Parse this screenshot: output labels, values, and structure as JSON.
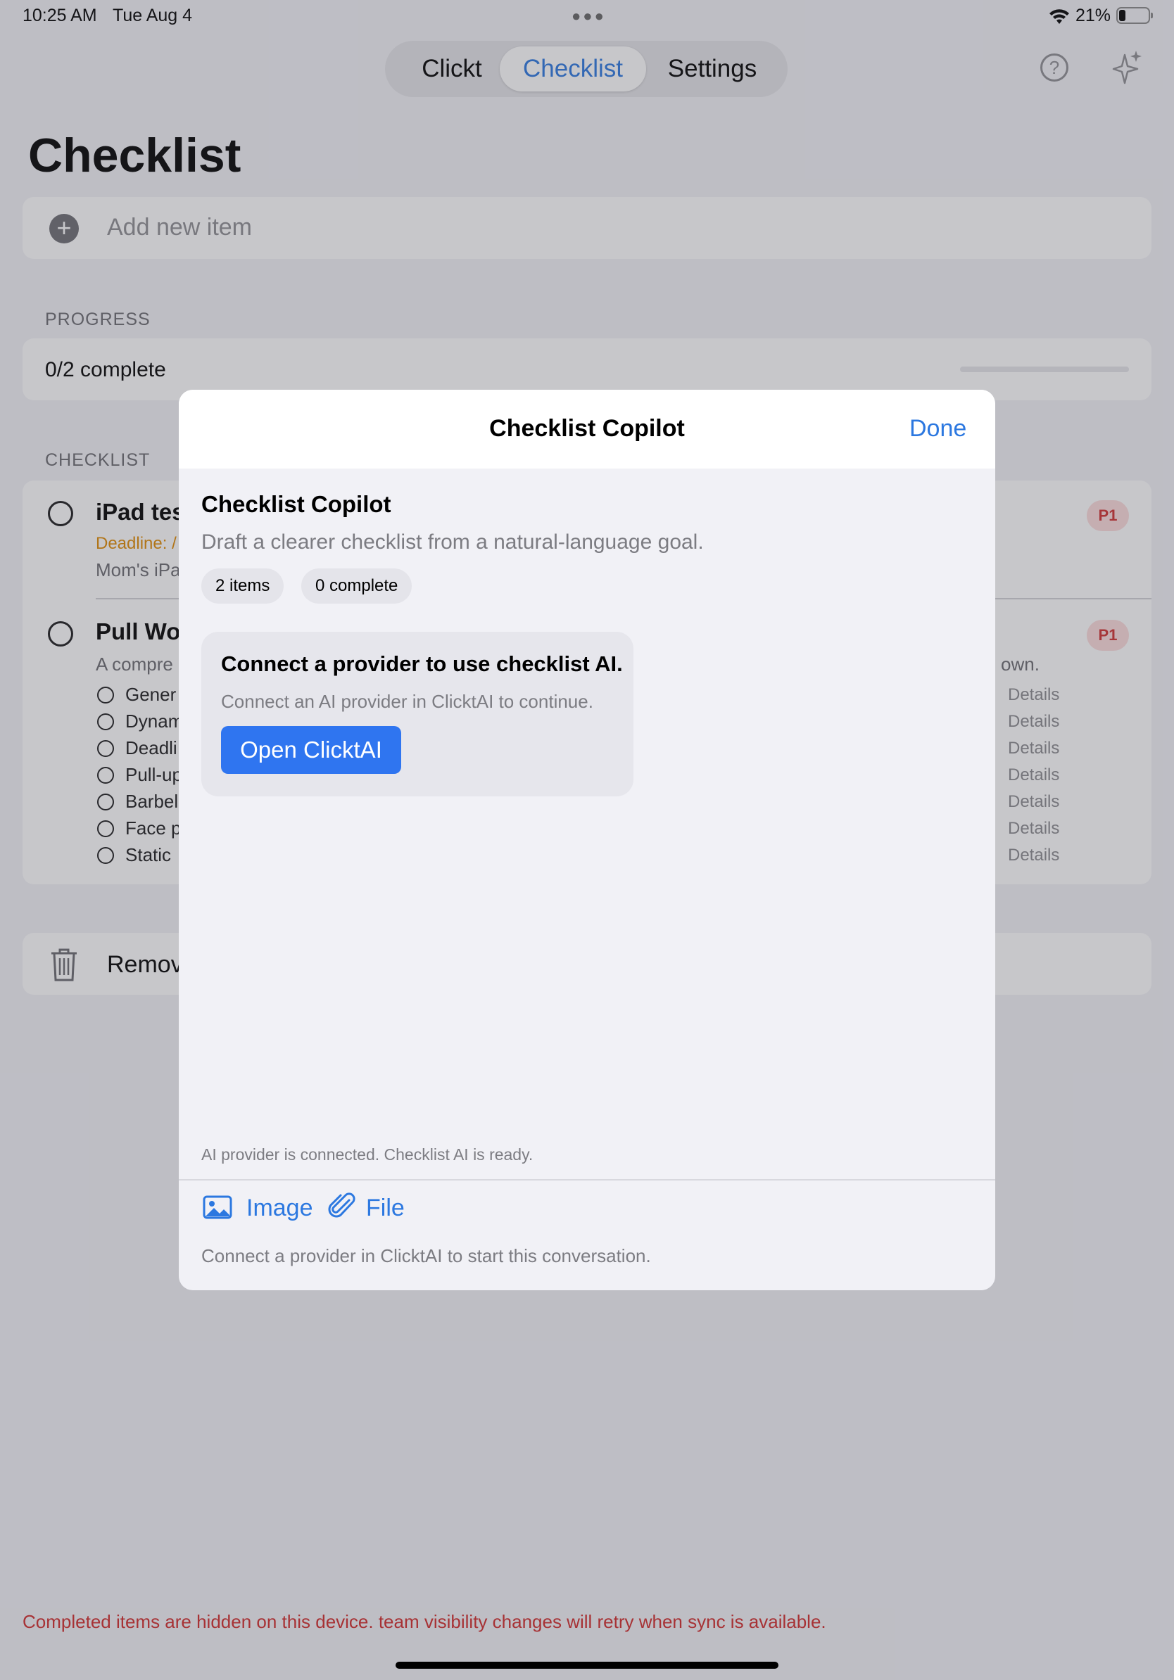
{
  "status_bar": {
    "time": "10:25 AM",
    "date": "Tue Aug 4",
    "battery": "21%"
  },
  "nav": {
    "tabs": [
      "Clickt",
      "Checklist",
      "Settings"
    ],
    "selected": "Checklist"
  },
  "page": {
    "title": "Checklist",
    "add_placeholder": "Add new item"
  },
  "progress": {
    "header": "PROGRESS",
    "text": "0/2 complete",
    "fraction": 0
  },
  "checklist": {
    "header": "CHECKLIST",
    "items": [
      {
        "title": "iPad tes",
        "deadline": "Deadline: /",
        "note": "Mom's iPa",
        "priority": "P1"
      },
      {
        "title": "Pull Wo",
        "description": "A compre",
        "description_end": "own.",
        "priority": "P1",
        "subitems": [
          {
            "label": "Gener",
            "action": "Details"
          },
          {
            "label": "Dynam",
            "action": "Details"
          },
          {
            "label": "Deadli",
            "action": "Details"
          },
          {
            "label": "Pull-up",
            "action": "Details"
          },
          {
            "label": "Barbel",
            "action": "Details"
          },
          {
            "label": "Face p",
            "action": "Details"
          },
          {
            "label": "Static",
            "action": "Details"
          }
        ]
      }
    ]
  },
  "remove": {
    "label": "Remov"
  },
  "footer": {
    "warning": "Completed items are hidden on this device. team visibility changes will retry when sync is available."
  },
  "sheet": {
    "title": "Checklist Copilot",
    "done": "Done",
    "heading": "Checklist Copilot",
    "subtitle": "Draft a clearer checklist from a natural-language goal.",
    "chips": [
      "2 items",
      "0 complete"
    ],
    "card": {
      "title": "Connect a provider to use checklist AI.",
      "body": "Connect an AI provider in ClicktAI to continue.",
      "button": "Open ClicktAI"
    },
    "status": "AI provider is connected. Checklist AI is ready.",
    "attach": {
      "image": "Image",
      "file": "File"
    },
    "composer_hint": "Connect a provider in ClicktAI to start this conversation."
  },
  "colors": {
    "accent": "#2c78e0",
    "button": "#2f75f0",
    "deadline": "#e08a00",
    "warning": "#d12a2a",
    "priority_bg": "#fcdcdc"
  },
  "icons": [
    "wifi-icon",
    "battery-icon",
    "help-icon",
    "sparkle-icon",
    "plus-icon",
    "trash-icon",
    "image-icon",
    "paperclip-icon"
  ]
}
